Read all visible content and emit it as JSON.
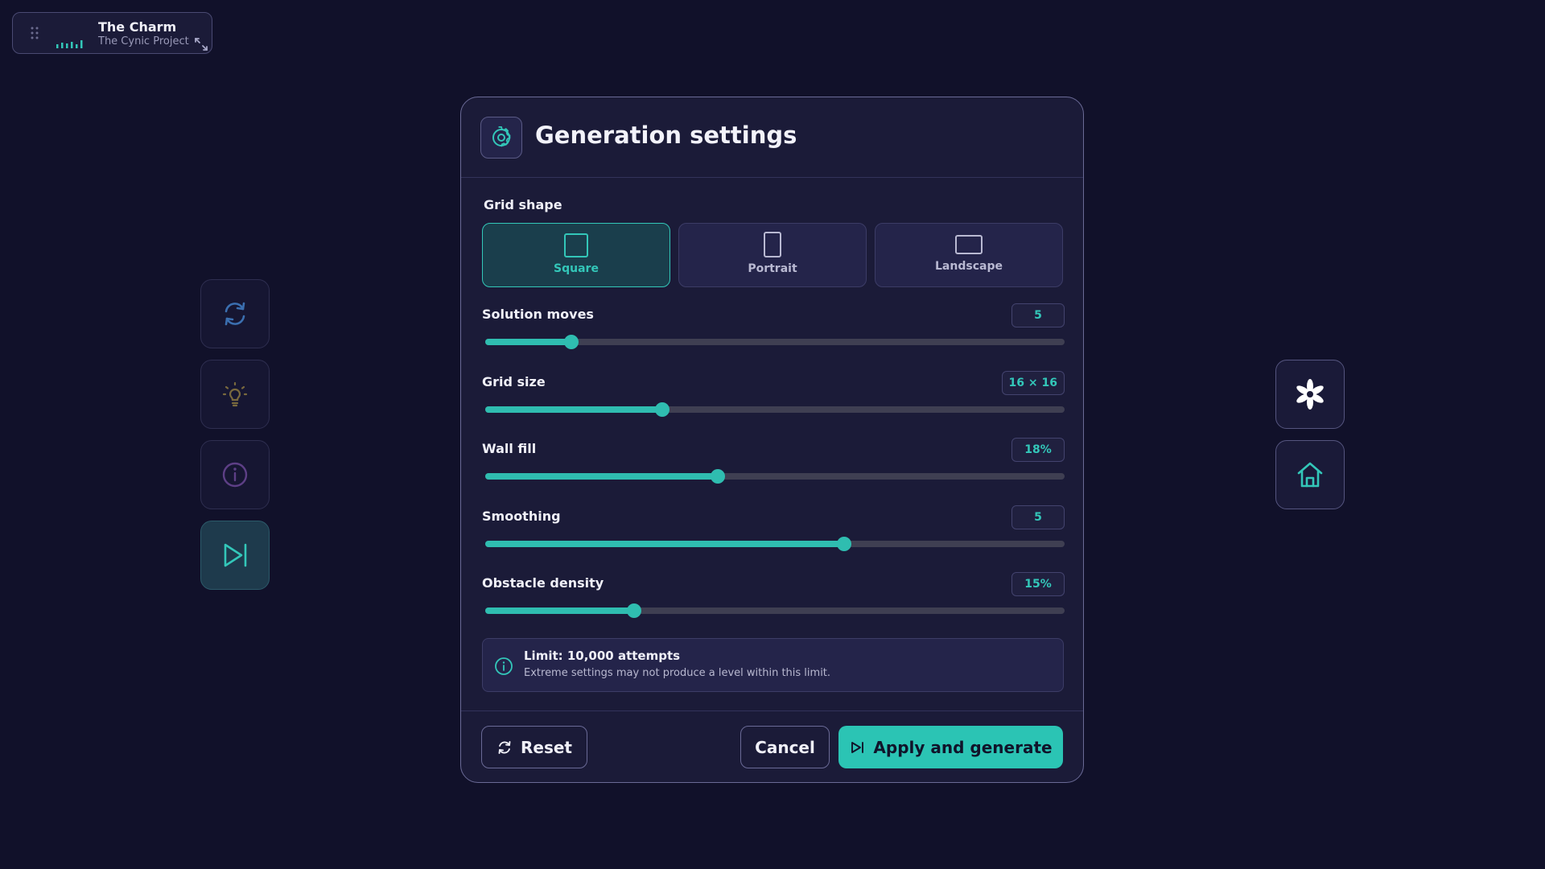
{
  "music": {
    "song": "The Charm",
    "artist": "The Cynic Project",
    "icons": [
      "drag-grip-icon",
      "equalizer-icon",
      "expand-icon"
    ]
  },
  "left_toolbar": {
    "buttons": [
      {
        "name": "restart",
        "icon": "refresh-icon"
      },
      {
        "name": "hint",
        "icon": "lightbulb-icon"
      },
      {
        "name": "info",
        "icon": "info-icon"
      },
      {
        "name": "skip",
        "icon": "skip-next-icon",
        "active": true
      }
    ]
  },
  "right_toolbar": {
    "buttons": [
      {
        "name": "settings",
        "icon": "flower-icon"
      },
      {
        "name": "home",
        "icon": "home-icon"
      }
    ]
  },
  "modal": {
    "title": "Generation settings",
    "grid_shape_label": "Grid shape",
    "shapes": [
      {
        "label": "Square",
        "selected": true
      },
      {
        "label": "Portrait",
        "selected": false
      },
      {
        "label": "Landscape",
        "selected": false
      }
    ],
    "settings": [
      {
        "label": "Solution moves",
        "value": "5",
        "fraction": 0.148
      },
      {
        "label": "Grid size",
        "value": "16 × 16",
        "fraction": 0.305
      },
      {
        "label": "Wall fill",
        "value": "18%",
        "fraction": 0.402
      },
      {
        "label": "Smoothing",
        "value": "5",
        "fraction": 0.62
      },
      {
        "label": "Obstacle density",
        "value": "15%",
        "fraction": 0.257
      }
    ],
    "info": {
      "title": "Limit: 10,000 attempts",
      "text": "Extreme settings may not produce a level within this limit."
    },
    "buttons": {
      "reset": "Reset",
      "cancel": "Cancel",
      "apply": "Apply and generate"
    }
  },
  "colors": {
    "accent": "#2bc4b4",
    "background": "#11112a",
    "panel": "#1b1b38"
  }
}
